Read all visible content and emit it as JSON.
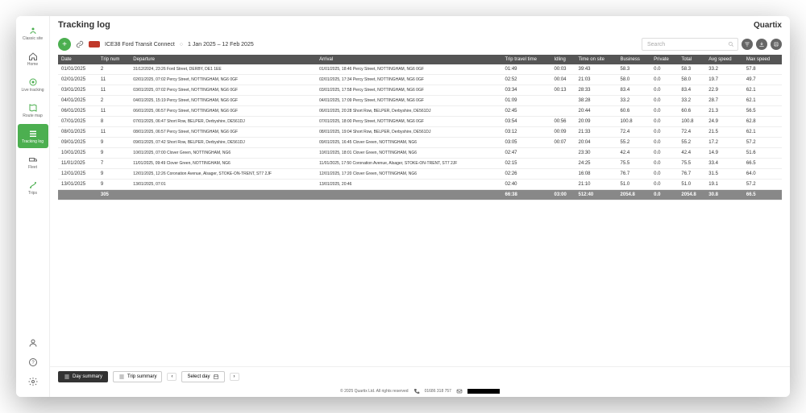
{
  "title": "Tracking log",
  "brand": "Quartix",
  "vehicle": "ICE38 Ford Transit Connect",
  "date_range": "1 Jan 2025 – 12 Feb 2025",
  "search_placeholder": "Search",
  "sidebar": {
    "items": [
      {
        "label": "Classic site"
      },
      {
        "label": "Home"
      },
      {
        "label": "Live tracking"
      },
      {
        "label": "Route map"
      },
      {
        "label": "Tracking log"
      },
      {
        "label": "Fleet"
      },
      {
        "label": "Trips"
      }
    ]
  },
  "columns": [
    "Date",
    "Trip num",
    "Departure",
    "Arrival",
    "Trip travel time",
    "Idling",
    "Time on site",
    "Business",
    "Private",
    "Total",
    "Avg speed",
    "Max speed"
  ],
  "rows": [
    {
      "date": "01/01/2025",
      "trip": "2",
      "dep": "31/12/2024, 23:26 Ford Street, DERBY, DE1 1EE",
      "arr": "01/01/2025, 18:46 Percy Street, NOTTINGHAM, NG6 0GF",
      "travel": "01:49",
      "idle": "00:03",
      "site": "39:43",
      "bus": "58.3",
      "priv": "0.0",
      "tot": "58.3",
      "avg": "33.2",
      "max": "57.8"
    },
    {
      "date": "02/01/2025",
      "trip": "11",
      "dep": "02/01/2025, 07:02 Percy Street, NOTTINGHAM, NG6 0GF",
      "arr": "02/01/2025, 17:34 Percy Street, NOTTINGHAM, NG6 0GF",
      "travel": "02:52",
      "idle": "00:04",
      "site": "21:03",
      "bus": "58.0",
      "priv": "0.0",
      "tot": "58.0",
      "avg": "19.7",
      "max": "49.7"
    },
    {
      "date": "03/01/2025",
      "trip": "11",
      "dep": "03/01/2025, 07:02 Percy Street, NOTTINGHAM, NG6 0GF",
      "arr": "03/01/2025, 17:58 Percy Street, NOTTINGHAM, NG6 0GF",
      "travel": "03:34",
      "idle": "00:13",
      "site": "28:33",
      "bus": "83.4",
      "priv": "0.0",
      "tot": "83.4",
      "avg": "22.9",
      "max": "62.1"
    },
    {
      "date": "04/01/2025",
      "trip": "2",
      "dep": "04/01/2025, 15:19 Percy Street, NOTTINGHAM, NG6 0GF",
      "arr": "04/01/2025, 17:09 Percy Street, NOTTINGHAM, NG6 0GF",
      "travel": "01:09",
      "idle": "",
      "site": "38:28",
      "bus": "33.2",
      "priv": "0.0",
      "tot": "33.2",
      "avg": "28.7",
      "max": "62.1"
    },
    {
      "date": "06/01/2025",
      "trip": "11",
      "dep": "06/01/2025, 06:57 Percy Street, NOTTINGHAM, NG6 0GF",
      "arr": "06/01/2025, 20:28 Short Row, BELPER, Derbyshire, DE561DJ",
      "travel": "02:45",
      "idle": "",
      "site": "20:44",
      "bus": "60.6",
      "priv": "0.0",
      "tot": "60.6",
      "avg": "21.3",
      "max": "56.5"
    },
    {
      "date": "07/01/2025",
      "trip": "8",
      "dep": "07/01/2025, 06:47 Short Row, BELPER, Derbyshire, DE561DJ",
      "arr": "07/01/2025, 18:00 Percy Street, NOTTINGHAM, NG6 0GF",
      "travel": "03:54",
      "idle": "00:56",
      "site": "20:09",
      "bus": "100.8",
      "priv": "0.0",
      "tot": "100.8",
      "avg": "24.9",
      "max": "62.8"
    },
    {
      "date": "08/01/2025",
      "trip": "11",
      "dep": "08/01/2025, 06:57 Percy Street, NOTTINGHAM, NG6 0GF",
      "arr": "08/01/2025, 19:04 Short Row, BELPER, Derbyshire, DE561DJ",
      "travel": "03:12",
      "idle": "00:09",
      "site": "21:33",
      "bus": "72.4",
      "priv": "0.0",
      "tot": "72.4",
      "avg": "21.5",
      "max": "62.1"
    },
    {
      "date": "09/01/2025",
      "trip": "9",
      "dep": "09/01/2025, 07:42 Short Row, BELPER, Derbyshire, DE561DJ",
      "arr": "09/01/2025, 16:45 Clover Green, NOTTINGHAM, NG6",
      "travel": "03:05",
      "idle": "00:07",
      "site": "20:04",
      "bus": "55.2",
      "priv": "0.0",
      "tot": "55.2",
      "avg": "17.2",
      "max": "57.2"
    },
    {
      "date": "10/01/2025",
      "trip": "9",
      "dep": "10/01/2025, 07:00 Clover Green, NOTTINGHAM, NG6",
      "arr": "10/01/2025, 18:01 Clover Green, NOTTINGHAM, NG6",
      "travel": "02:47",
      "idle": "",
      "site": "23:30",
      "bus": "42.4",
      "priv": "0.0",
      "tot": "42.4",
      "avg": "14.9",
      "max": "51.6"
    },
    {
      "date": "11/01/2025",
      "trip": "7",
      "dep": "11/01/2025, 09:49 Clover Green, NOTTINGHAM, NG6",
      "arr": "11/01/2025, 17:50 Coronation Avenue, Alsager, STOKE-ON-TRENT, ST7 2JF",
      "travel": "02:15",
      "idle": "",
      "site": "24:25",
      "bus": "75.5",
      "priv": "0.0",
      "tot": "75.5",
      "avg": "33.4",
      "max": "66.5"
    },
    {
      "date": "12/01/2025",
      "trip": "9",
      "dep": "12/01/2025, 12:26 Coronation Avenue, Alsager, STOKE-ON-TRENT, ST7 2JF",
      "arr": "12/01/2025, 17:20 Clover Green, NOTTINGHAM, NG6",
      "travel": "02:26",
      "idle": "",
      "site": "16:08",
      "bus": "76.7",
      "priv": "0.0",
      "tot": "76.7",
      "avg": "31.5",
      "max": "64.0"
    },
    {
      "date": "13/01/2025",
      "trip": "9",
      "dep": "13/01/2025, 07:01",
      "arr": "13/01/2025, 20:46",
      "travel": "02:40",
      "idle": "",
      "site": "21:10",
      "bus": "51.0",
      "priv": "0.0",
      "tot": "51.0",
      "avg": "19.1",
      "max": "57.2"
    }
  ],
  "totals": {
    "trip": "305",
    "travel": "66:38",
    "idle": "03:00",
    "site": "512:40",
    "bus": "2054.8",
    "priv": "0.0",
    "tot": "2054.8",
    "avg": "30.8",
    "max": "66.5"
  },
  "bottom": {
    "day": "Day summary",
    "trip": "Trip summary",
    "select": "Select day"
  },
  "footer": {
    "copy": "© 2025 Quartix Ltd. All rights reserved",
    "phone": "01686 318 757"
  }
}
